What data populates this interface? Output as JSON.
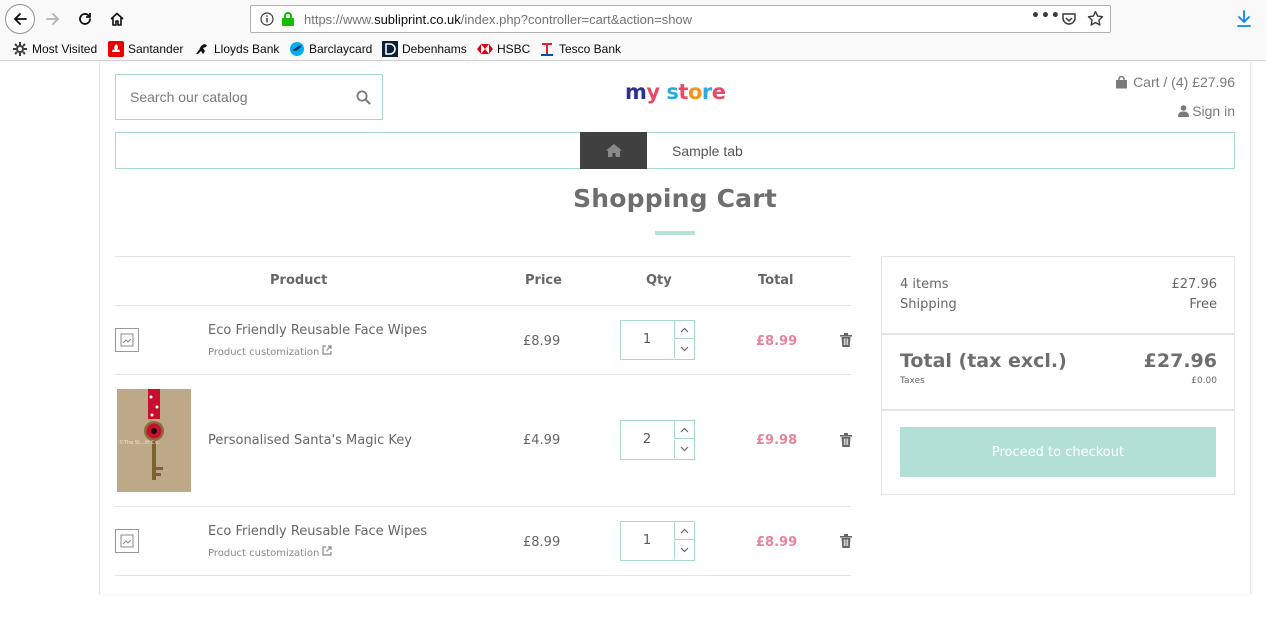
{
  "browser": {
    "url_scheme_host": "https://www.",
    "url_host": "subliprint.co.uk",
    "url_path": "/index.php?controller=cart&action=show",
    "more_label": "•••",
    "bookmarks": [
      {
        "label": "Most Visited",
        "icon": "gear-icon"
      },
      {
        "label": "Santander",
        "icon": "santander-icon",
        "color": "#ec0000"
      },
      {
        "label": "Lloyds Bank",
        "icon": "horse-icon",
        "color": "#000000"
      },
      {
        "label": "Barclaycard",
        "icon": "eagle-icon",
        "color": "#00395d"
      },
      {
        "label": "Debenhams",
        "icon": "debenhams-icon",
        "color": "#0b1f3a"
      },
      {
        "label": "HSBC",
        "icon": "hsbc-icon",
        "color": "#db0011"
      },
      {
        "label": "Tesco Bank",
        "icon": "tesco-icon",
        "color": "#ee1c2e"
      }
    ]
  },
  "header": {
    "search_placeholder": "Search our catalog",
    "logo_letters": [
      "m",
      "y",
      " ",
      "s",
      "t",
      "o",
      "r",
      "e"
    ],
    "logo_colors": [
      "#2e3192",
      "#e84b6a",
      "#ffffff",
      "#29abe2",
      "#e84b6a",
      "#f7931e",
      "#29abe2",
      "#e84b6a"
    ],
    "cart_label": "Cart / (4) £27.96",
    "signin_label": "Sign in",
    "menu_tab": "Sample tab"
  },
  "page_title": "Shopping Cart",
  "cart": {
    "columns": [
      "Product",
      "Price",
      "Qty",
      "Total"
    ],
    "items": [
      {
        "name": "Eco Friendly Reusable Face Wipes",
        "customization": "Product customization",
        "price": "£8.99",
        "qty": "1",
        "total": "£8.99",
        "image": "placeholder"
      },
      {
        "name": "Personalised Santa's Magic Key",
        "customization": "",
        "price": "£4.99",
        "qty": "2",
        "total": "£9.98",
        "image": "photo",
        "image_watermark": "©The St...ift Co."
      },
      {
        "name": "Eco Friendly Reusable Face Wipes",
        "customization": "Product customization",
        "price": "£8.99",
        "qty": "1",
        "total": "£8.99",
        "image": "placeholder"
      }
    ]
  },
  "summary": {
    "items_label": "4 items",
    "items_value": "£27.96",
    "shipping_label": "Shipping",
    "shipping_value": "Free",
    "total_label": "Total (tax excl.)",
    "total_value": "£27.96",
    "taxes_label": "Taxes",
    "taxes_value": "£0.00",
    "checkout_label": "Proceed to checkout"
  },
  "colors": {
    "accent": "#a8d7cc",
    "price_total": "#e8839b",
    "checkout_bg": "#b3e0d6",
    "menu_home_bg": "#404040"
  }
}
